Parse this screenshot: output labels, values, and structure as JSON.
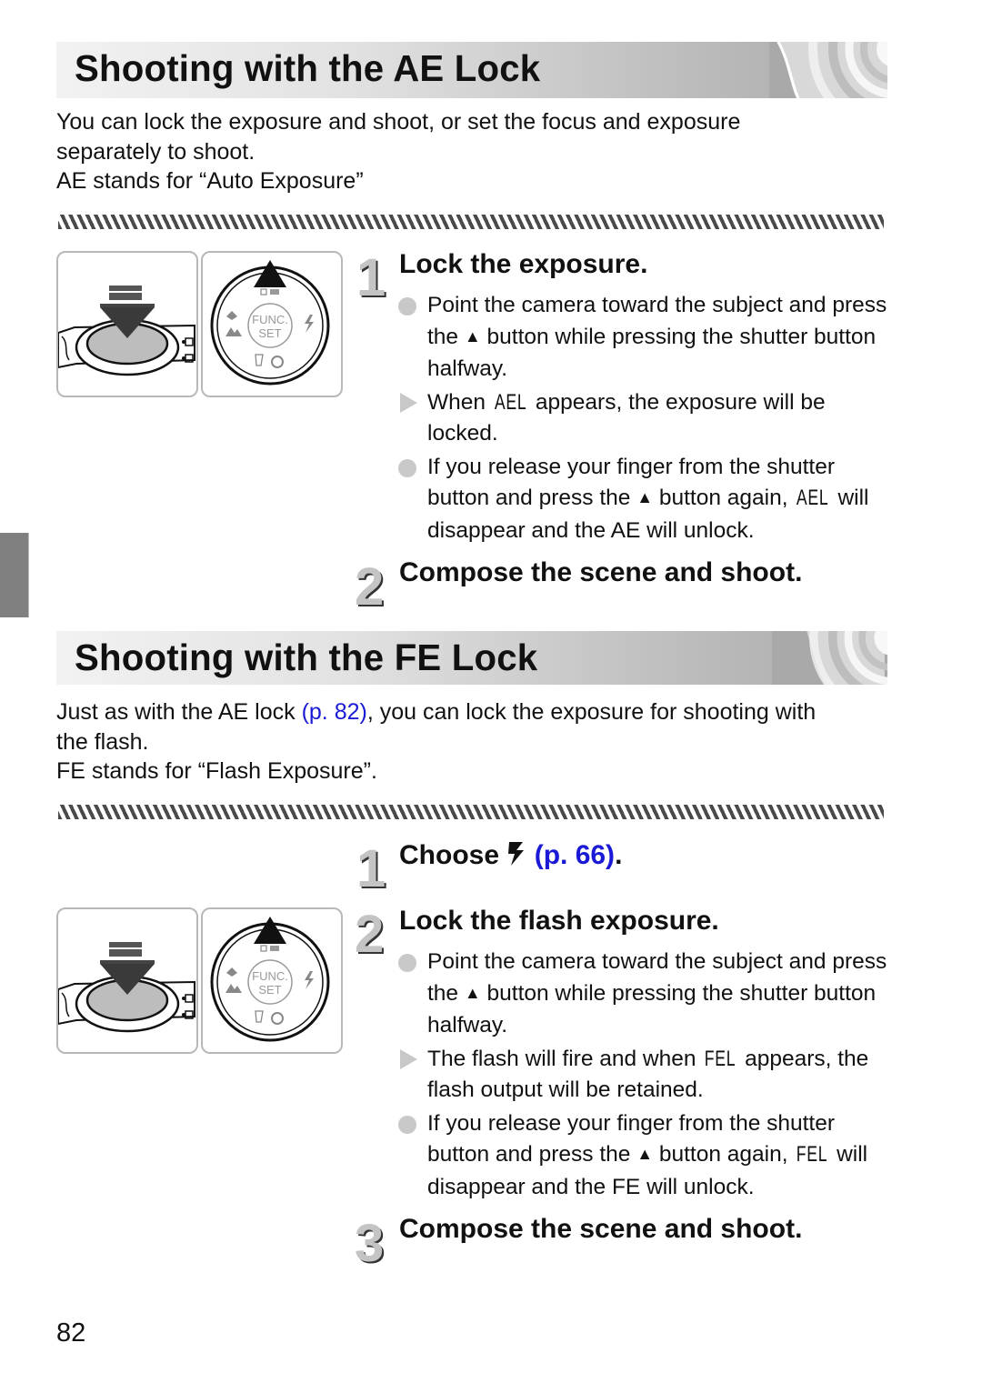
{
  "page_number": "82",
  "colors": {
    "link": "#1a1ad6",
    "banner_light": "#f2f2f2",
    "banner_dark": "#a9a9a9",
    "bullet_marker": "#c8c8c8",
    "side_tab": "#808080"
  },
  "sections": [
    {
      "title": "Shooting with the AE Lock",
      "intro": {
        "line1": "You can lock the exposure and shoot, or set the focus and exposure",
        "line2": "separately to shoot.",
        "line3": "AE stands for “Auto Exposure”"
      },
      "illustrations": [
        "shutter-button-half-press",
        "control-dial-up-button"
      ],
      "dial_labels": {
        "center_line1": "FUNC.",
        "center_line2": "SET"
      },
      "steps": [
        {
          "number": "1",
          "title": "Lock the exposure.",
          "bullets": [
            {
              "marker": "dot",
              "parts": [
                "Point the camera toward the subject and press the ",
                "▲",
                " button while pressing the shutter button halfway."
              ]
            },
            {
              "marker": "triangle",
              "parts": [
                "When ",
                "AEL",
                " appears, the exposure will be locked."
              ]
            },
            {
              "marker": "dot",
              "parts": [
                "If you release your finger from the shutter button and press the ",
                "▲",
                " button again, ",
                "AEL",
                " will disappear and the AE will unlock."
              ]
            }
          ]
        },
        {
          "number": "2",
          "title": "Compose the scene and shoot."
        }
      ]
    },
    {
      "title": "Shooting with the FE Lock",
      "intro": {
        "before_link": "Just as with the AE lock ",
        "link": "(p. 82)",
        "after_link": ", you can lock the exposure for shooting with",
        "line2": "the flash.",
        "line3": "FE stands for “Flash Exposure”."
      },
      "illustrations": [
        "shutter-button-half-press",
        "control-dial-up-button"
      ],
      "dial_labels": {
        "center_line1": "FUNC.",
        "center_line2": "SET"
      },
      "steps": [
        {
          "number": "1",
          "title_before": "Choose ",
          "title_icon": "flash-icon",
          "title_link": "(p. 66)",
          "title_after": "."
        },
        {
          "number": "2",
          "title": "Lock the flash exposure.",
          "bullets": [
            {
              "marker": "dot",
              "parts": [
                "Point the camera toward the subject and press the ",
                "▲",
                " button while pressing the shutter button halfway."
              ]
            },
            {
              "marker": "triangle",
              "parts": [
                "The flash will fire and when ",
                "FEL",
                " appears, the flash output will be retained."
              ]
            },
            {
              "marker": "dot",
              "parts": [
                "If you release your finger from the shutter button and press the ",
                "▲",
                " button again, ",
                "FEL",
                " will disappear and the FE will unlock."
              ]
            }
          ]
        },
        {
          "number": "3",
          "title": "Compose the scene and shoot."
        }
      ]
    }
  ]
}
